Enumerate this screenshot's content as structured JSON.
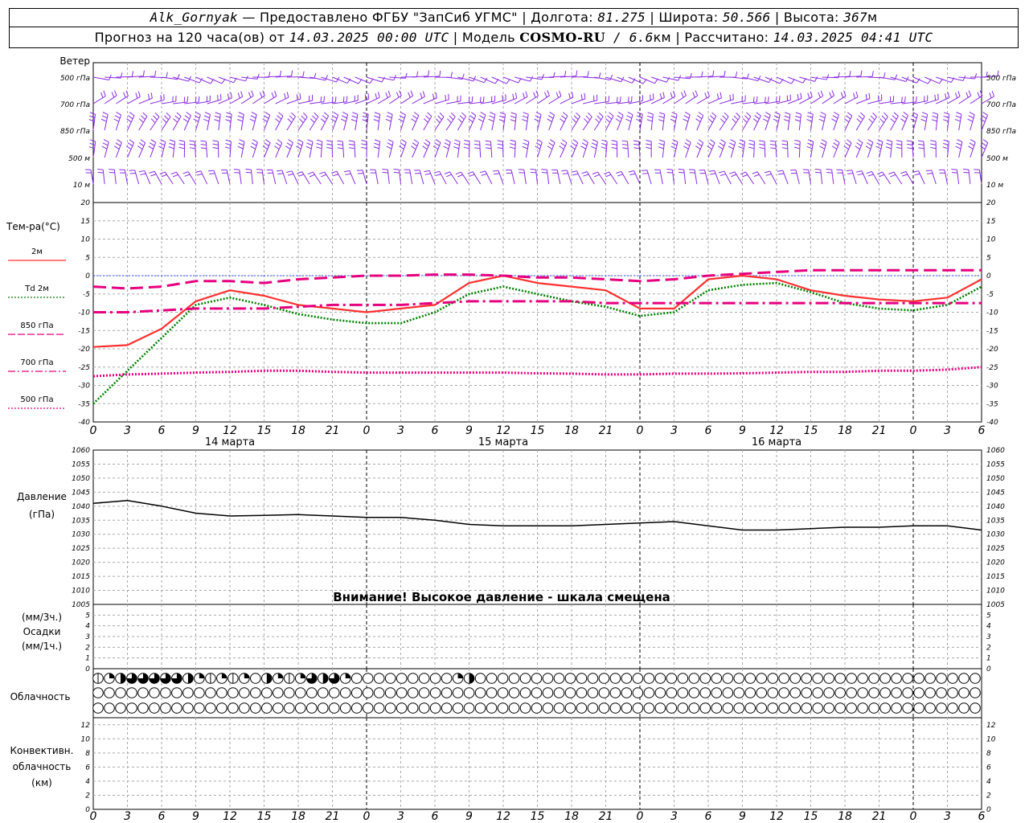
{
  "header": {
    "station": "Alk_Gornyak",
    "provided": " — Предоставлено ФГБУ \"ЗапСиб УГМС\" | Долгота: ",
    "lon": "81.275",
    "lat_label": " | Широта: ",
    "lat": "50.566",
    "alt_label": " | Высота: ",
    "alt": "367",
    "alt_unit": "м",
    "forecast_label": "Прогноз на 120 часа(ов) от ",
    "forecast_time": "14.03.2025 00:00 UTC",
    "model_label": " | Модель ",
    "model": "COSMO-RU",
    "res": " / 6.6",
    "res_unit": "км",
    "calc_label": " | Рассчитано: ",
    "calc_time": "14.03.2025 04:41 UTC"
  },
  "wind_panel": {
    "title": "Ветер",
    "levels": [
      "500 гПа",
      "700 гПа",
      "850 гПа",
      "500 м",
      "10 м"
    ],
    "color": "#8a2be2"
  },
  "temp_panel": {
    "title": "Тем-ра(°С)",
    "legend": [
      {
        "label": "2м",
        "color": "#ff3030",
        "dash": "solid"
      },
      {
        "label": "Td 2м",
        "color": "#008000",
        "dash": "dot"
      },
      {
        "label": "850 гПа",
        "color": "#e6007e",
        "dash": "dash"
      },
      {
        "label": "700 гПа",
        "color": "#e6007e",
        "dash": "dashdot"
      },
      {
        "label": "500 гПа",
        "color": "#e6007e",
        "dash": "dot"
      }
    ],
    "y_ticks": [
      "20",
      "15",
      "10",
      "5",
      "0",
      "-5",
      "-10",
      "-15",
      "-20",
      "-25",
      "-30",
      "-35",
      "-40"
    ]
  },
  "x_axis": {
    "ticks": [
      "0",
      "3",
      "6",
      "9",
      "12",
      "15",
      "18",
      "21",
      "0",
      "3",
      "6",
      "9",
      "12",
      "15",
      "18",
      "21",
      "0",
      "3",
      "6",
      "9",
      "12",
      "15",
      "18",
      "21",
      "0",
      "3",
      "6"
    ],
    "days": [
      "14 марта",
      "15 марта",
      "16 марта"
    ]
  },
  "pressure_panel": {
    "title": "Давление",
    "unit": "(гПа)",
    "y_ticks": [
      "1060",
      "1055",
      "1050",
      "1045",
      "1040",
      "1035",
      "1030",
      "1025",
      "1020",
      "1015",
      "1010",
      "1005"
    ],
    "warning": "Внимание! Высокое давление - шкала смещена"
  },
  "precip_panel": {
    "unit_3h": "(мм/3ч.)",
    "title": "Осадки",
    "unit_1h": "(мм/1ч.)",
    "y_ticks": [
      "5",
      "4",
      "3",
      "2",
      "1",
      "0"
    ]
  },
  "cloud_panel": {
    "title": "Облачность"
  },
  "conv_panel": {
    "title_1": "Конвективн.",
    "title_2": "облачность",
    "unit": "(км)",
    "y_ticks": [
      "12",
      "10",
      "8",
      "6",
      "4",
      "2",
      "0"
    ]
  },
  "chart_data": {
    "type": "line",
    "x_hours": [
      0,
      3,
      6,
      9,
      12,
      15,
      18,
      21,
      24,
      27,
      30,
      33,
      36,
      39,
      42,
      45,
      48,
      51,
      54,
      57,
      60,
      63,
      66,
      69,
      72,
      75,
      78
    ],
    "series": [
      {
        "name": "2м",
        "values": [
          -19.5,
          -19,
          -14.5,
          -7,
          -4,
          -5.5,
          -8,
          -9,
          -10,
          -9,
          -8,
          -2,
          0,
          -2,
          -3,
          -4,
          -9,
          -9,
          -1,
          0,
          -1,
          -4,
          -5.5,
          -6.5,
          -7,
          -6,
          -1
        ]
      },
      {
        "name": "Td 2м",
        "values": [
          -35,
          -26,
          -17,
          -8,
          -6,
          -8,
          -10.5,
          -12,
          -13,
          -13,
          -10,
          -5,
          -3,
          -5,
          -7,
          -8.5,
          -11,
          -10,
          -4,
          -2.5,
          -2,
          -4.5,
          -7.5,
          -9,
          -9.5,
          -8,
          -3
        ]
      },
      {
        "name": "850 гПа",
        "values": [
          -3,
          -3.5,
          -3,
          -1.5,
          -1.5,
          -2,
          -1,
          -0.5,
          0,
          0,
          0.3,
          0.3,
          0,
          -0.5,
          -0.5,
          -1,
          -1.5,
          -1,
          0,
          0.5,
          1,
          1.5,
          1.5,
          1.5,
          1.5,
          1.5,
          1.5
        ]
      },
      {
        "name": "700 гПа",
        "values": [
          -10,
          -10,
          -9.5,
          -9,
          -9,
          -9,
          -8.5,
          -8,
          -8,
          -8,
          -7.5,
          -7,
          -7,
          -7,
          -7,
          -7.5,
          -7.5,
          -7.5,
          -7.5,
          -7.5,
          -7.5,
          -7.5,
          -7.5,
          -7.5,
          -7.5,
          -7.5,
          -7.5
        ]
      },
      {
        "name": "500 гПа",
        "values": [
          -27.5,
          -27,
          -26.8,
          -26.5,
          -26.3,
          -26,
          -26,
          -26.3,
          -26.5,
          -26.5,
          -26.5,
          -26.5,
          -26.5,
          -26.7,
          -26.8,
          -27,
          -27,
          -26.8,
          -26.8,
          -26.7,
          -26.5,
          -26.3,
          -26.3,
          -26,
          -26,
          -25.7,
          -25
        ]
      },
      {
        "name": "Давление",
        "values": [
          1041,
          1042,
          1040,
          1037.5,
          1036.5,
          1036.7,
          1037,
          1036.5,
          1036,
          1036,
          1035,
          1033.5,
          1033,
          1033,
          1033,
          1033.5,
          1034,
          1034.5,
          1033,
          1031.5,
          1031.5,
          1032,
          1032.5,
          1032.5,
          1033,
          1033,
          1031.5
        ]
      }
    ],
    "temp_ylim": [
      -40,
      20
    ],
    "pressure_ylim": [
      1005,
      1060
    ],
    "precip_ylim": [
      0,
      5
    ],
    "conv_ylim": [
      0,
      13
    ],
    "clouds_low": [
      1,
      2,
      3,
      4,
      4,
      4,
      4,
      4,
      3,
      2,
      1,
      2,
      1,
      2,
      0,
      3,
      2,
      1,
      2,
      4,
      3,
      4,
      2,
      0,
      0,
      0,
      0,
      0,
      0,
      0,
      0,
      0,
      2,
      3,
      0,
      0,
      0,
      0,
      0,
      0,
      0,
      0,
      0,
      0,
      0,
      0,
      0,
      0,
      0,
      0,
      0,
      0,
      0,
      0,
      0,
      0,
      0,
      0,
      0,
      0,
      0,
      0,
      0,
      0,
      0,
      0,
      0,
      0,
      0,
      0,
      0,
      0,
      0,
      0,
      0,
      0,
      0,
      0,
      0,
      0,
      0,
      0,
      0,
      0,
      0,
      0,
      0,
      0,
      0,
      0,
      0,
      0,
      0,
      0,
      0,
      0,
      0,
      0,
      0,
      0,
      0,
      0,
      0,
      0,
      0,
      0,
      0,
      0,
      0,
      0,
      0,
      0,
      0,
      0,
      0,
      0,
      0,
      0,
      0,
      2
    ],
    "wind_color": "#8a2be2"
  }
}
